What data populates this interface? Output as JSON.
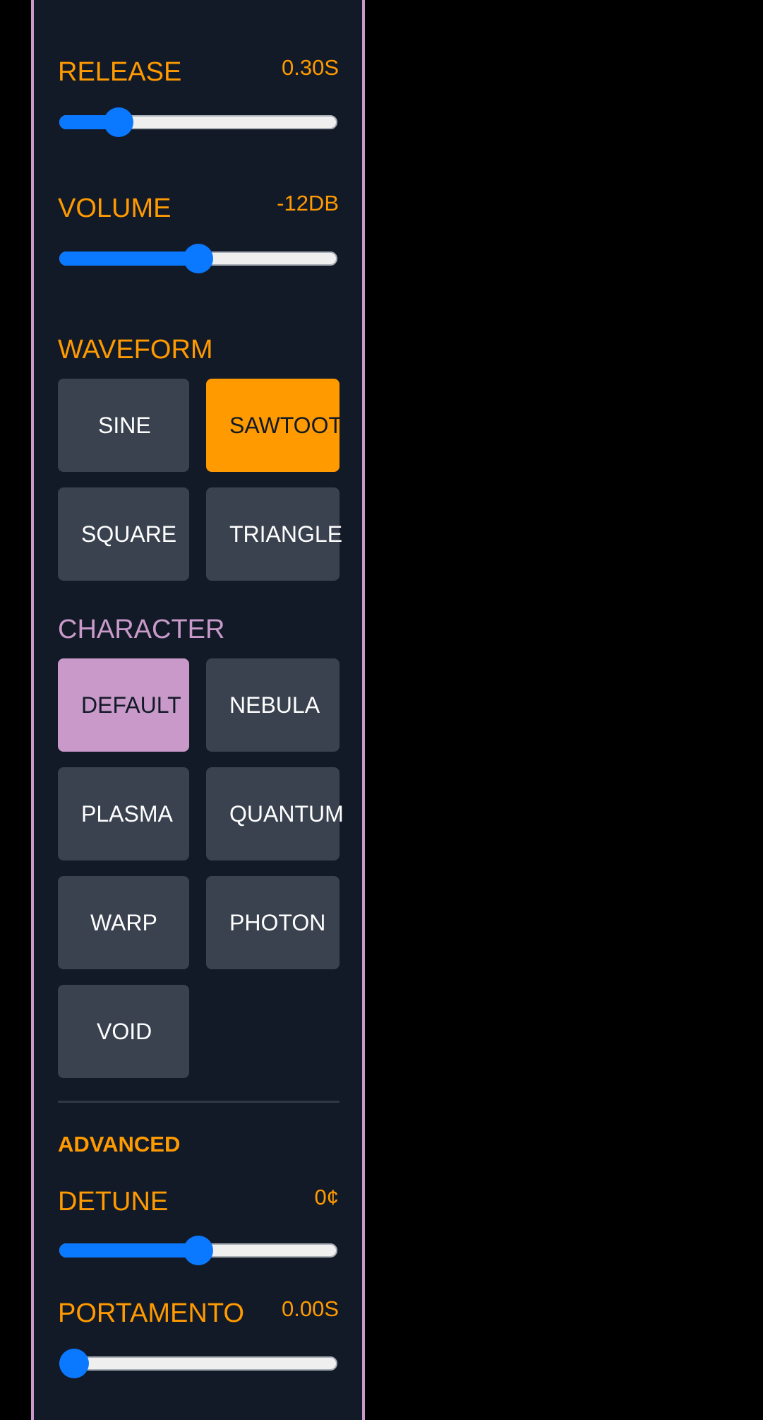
{
  "colors": {
    "panel_bg": "#131a27",
    "panel_border": "#c99ac9",
    "accent_orange": "#ff9a00",
    "accent_pink": "#c99ac9",
    "slider_blue": "#0a78ff",
    "button_bg": "#3a4250"
  },
  "params": {
    "release": {
      "label": "RELEASE",
      "value": "0.30S",
      "level": 0.18
    },
    "volume": {
      "label": "VOLUME",
      "value": "-12DB",
      "level": 0.5
    }
  },
  "waveform": {
    "title": "WAVEFORM",
    "options": [
      "SINE",
      "SAWTOOTH",
      "SQUARE",
      "TRIANGLE"
    ],
    "selected": "SAWTOOTH"
  },
  "character": {
    "title": "CHARACTER",
    "options": [
      "DEFAULT",
      "NEBULA",
      "PLASMA",
      "QUANTUM",
      "WARP",
      "PHOTON",
      "VOID"
    ],
    "selected": "DEFAULT"
  },
  "advanced": {
    "title": "ADVANCED",
    "detune": {
      "label": "DETUNE",
      "value": "0¢",
      "level": 0.5
    },
    "portamento": {
      "label": "PORTAMENTO",
      "value": "0.00S",
      "level": 0.0
    }
  }
}
